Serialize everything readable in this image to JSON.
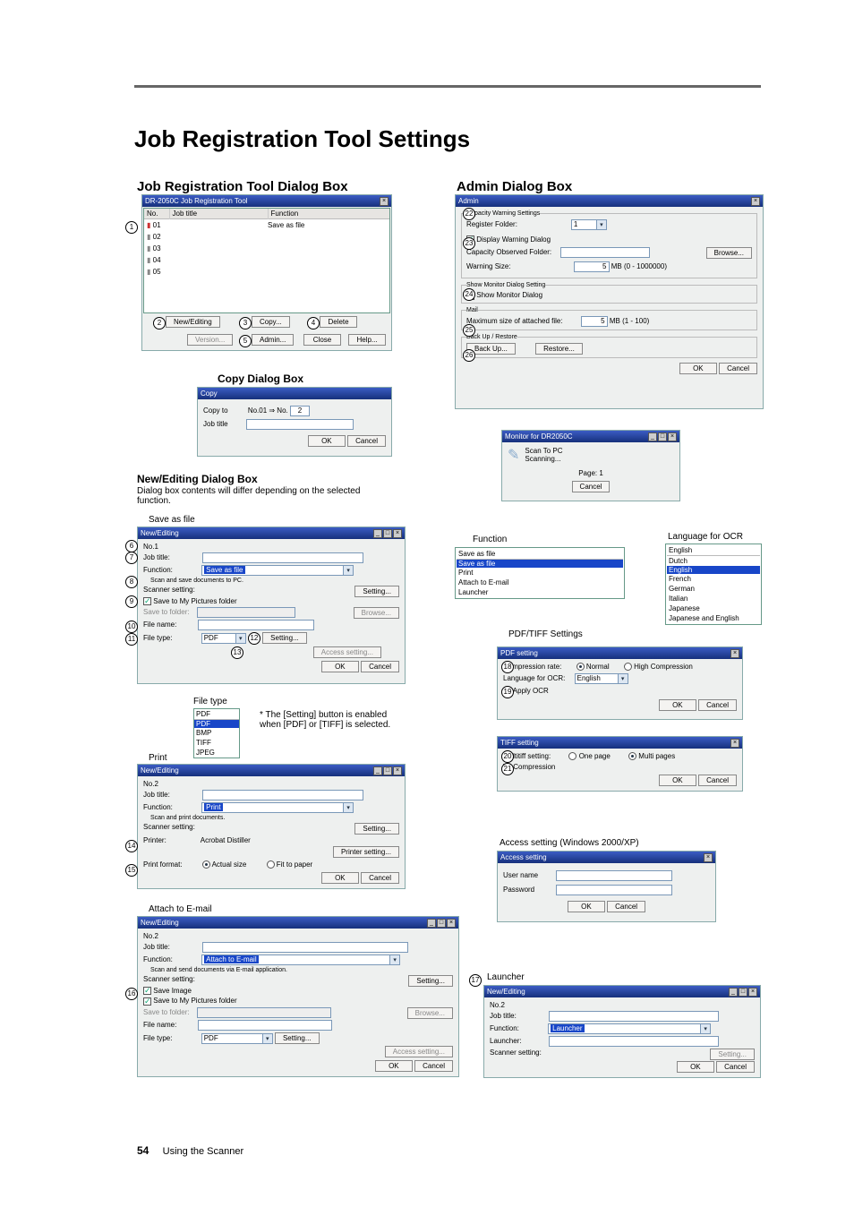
{
  "page": {
    "title": "Job Registration Tool Settings",
    "section_left": "Job Registration Tool Dialog Box",
    "section_right": "Admin Dialog Box",
    "footer_page": "54",
    "footer_text": "Using the Scanner"
  },
  "main_tool": {
    "title": "DR-2050C Job Registration Tool",
    "col_no": "No.",
    "col_jobtitle": "Job title",
    "col_function": "Function",
    "rows": [
      "01",
      "02",
      "03",
      "04",
      "05"
    ],
    "function_value": "Save as file",
    "btn_newedit": "New/Editing",
    "btn_copy": "Copy...",
    "btn_delete": "Delete",
    "btn_version": "Version...",
    "btn_admin": "Admin...",
    "btn_close": "Close",
    "btn_help": "Help..."
  },
  "copy": {
    "heading": "Copy Dialog Box",
    "title": "Copy",
    "copyto": "Copy to",
    "copyto_val": "No.01 ⇒ No.",
    "spin_val": "2",
    "jobtitle": "Job title",
    "ok": "OK",
    "cancel": "Cancel"
  },
  "newedit": {
    "heading": "New/Editing Dialog Box",
    "subtext": "Dialog box contents will differ depending on the selected function."
  },
  "saveasfile": {
    "caption": "Save as file",
    "title": "New/Editing",
    "no": "No.1",
    "jobtitle_l": "Job title:",
    "function_l": "Function:",
    "function_v": "Save as file",
    "desc": "Scan and save documents to PC.",
    "scanner_l": "Scanner setting:",
    "btn_setting": "Setting...",
    "save_chk": "Save to My Pictures folder",
    "saveto_l": "Save to folder:",
    "browse": "Browse...",
    "filename_l": "File name:",
    "filetype_l": "File type:",
    "filetype_v": "PDF",
    "btn_setting2": "Setting...",
    "access_btn": "Access setting...",
    "ok": "OK",
    "cancel": "Cancel"
  },
  "filetype": {
    "caption": "File type",
    "options": [
      "PDF",
      "PDF",
      "BMP",
      "TIFF",
      "JPEG"
    ],
    "note": "* The [Setting] button is enabled when [PDF] or [TIFF] is selected."
  },
  "print": {
    "caption": "Print",
    "title": "New/Editing",
    "no": "No.2",
    "jobtitle_l": "Job title:",
    "function_l": "Function:",
    "function_v": "Print",
    "desc": "Scan and print documents.",
    "scanner_l": "Scanner setting:",
    "btn_setting": "Setting...",
    "printer_l": "Printer:",
    "printer_v": "Acrobat Distiller",
    "printer_btn": "Printer setting...",
    "format_l": "Print format:",
    "actual": "Actual size",
    "fit": "Fit to paper",
    "ok": "OK",
    "cancel": "Cancel"
  },
  "attach": {
    "caption": "Attach to E-mail",
    "title": "New/Editing",
    "no": "No.2",
    "jobtitle_l": "Job title:",
    "function_l": "Function:",
    "function_v": "Attach to E-mail",
    "desc": "Scan and send documents via E-mail application.",
    "scanner_l": "Scanner setting:",
    "btn_setting": "Setting...",
    "saveimg": "Save Image",
    "savemy": "Save to My Pictures folder",
    "saveto_l": "Save to folder:",
    "browse": "Browse...",
    "filename_l": "File name:",
    "filetype_l": "File type:",
    "filetype_v": "PDF",
    "btn_setting2": "Setting...",
    "access_btn": "Access setting...",
    "ok": "OK",
    "cancel": "Cancel"
  },
  "admin": {
    "title": "Admin",
    "group_cap": "Capacity Warning Settings",
    "regfolder": "Register Folder:",
    "regfolder_v": "1",
    "display_chk": "Display Warning Dialog",
    "capfolder": "Capacity Observed Folder:",
    "browse": "Browse...",
    "warnsize": "Warning Size:",
    "warnsize_v": "5",
    "warnsize_u": "MB (0 - 1000000)",
    "group_monitor": "Show Monitor Dialog Setting",
    "show_chk": "Show Monitor Dialog",
    "group_mail": "Mail",
    "maxattach": "Maximum size of attached file:",
    "max_v": "5",
    "max_u": "MB (1 - 100)",
    "group_back": "Back Up / Restore",
    "backup": "Back Up...",
    "restore": "Restore...",
    "ok": "OK",
    "cancel": "Cancel"
  },
  "monitor": {
    "title": "Monitor for DR2050C",
    "scan": "Scan To PC",
    "scanning": "Scanning...",
    "page": "Page:",
    "page_v": "1",
    "cancel": "Cancel"
  },
  "function_list": {
    "caption": "Function",
    "items": [
      "Save as file",
      "Save as file",
      "Print",
      "Attach to E-mail",
      "Launcher"
    ]
  },
  "lang": {
    "caption": "Language for OCR",
    "items": [
      "English",
      "Dutch",
      "English",
      "French",
      "German",
      "Italian",
      "Japanese",
      "Japanese and English"
    ]
  },
  "pdf": {
    "caption": "PDF/TIFF Settings",
    "title_pdf": "PDF setting",
    "comp_l": "Compression rate:",
    "normal": "Normal",
    "high": "High Compression",
    "langocr": "Language for OCR:",
    "langocr_v": "English",
    "apply": "Apply OCR",
    "ok": "OK",
    "cancel": "Cancel",
    "title_tiff": "TIFF setting",
    "multi_l": "Multitiff setting:",
    "one": "One page",
    "multi": "Multi pages",
    "compress": "Compression"
  },
  "access": {
    "caption": "Access setting (Windows 2000/XP)",
    "title": "Access setting",
    "user": "User name",
    "pass": "Password",
    "ok": "OK",
    "cancel": "Cancel"
  },
  "launcher": {
    "caption": "Launcher",
    "title": "New/Editing",
    "no": "No.2",
    "jobtitle_l": "Job title:",
    "function_l": "Function:",
    "function_v": "Launcher",
    "launcher_l": "Launcher:",
    "scanner_l": "Scanner setting:",
    "btn_setting": "Setting...",
    "ok": "OK",
    "cancel": "Cancel"
  },
  "chart_data": null
}
